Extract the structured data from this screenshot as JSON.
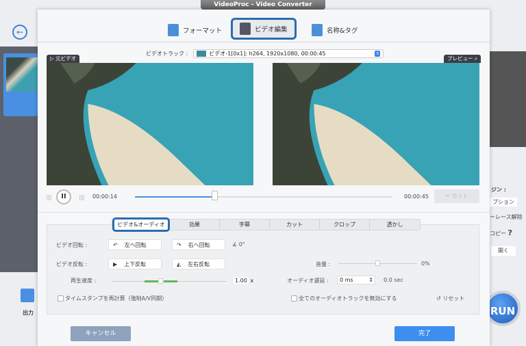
{
  "window": {
    "title": "VideoProc - Video Converter"
  },
  "background": {
    "output_label": "出力",
    "right_panel": {
      "heading": "ジン :",
      "option_btn": "プション",
      "deinterlace": "ーレース解除",
      "copy": "コピー",
      "help": "?",
      "open_btn": "開く"
    },
    "run_label": "RUN"
  },
  "top_tabs": [
    {
      "label": "フォーマット",
      "icon": "format-icon"
    },
    {
      "label": "ビデオ編集",
      "icon": "video-edit-icon",
      "selected": true
    },
    {
      "label": "名称&タグ",
      "icon": "name-tag-icon"
    }
  ],
  "track": {
    "label": "ビデオトラック :",
    "value": "ビデオ-1[0x1]: h264, 1920x1080, 00:00:45"
  },
  "source_label": "▷ 元ビデオ",
  "preview_label": "プレビュー",
  "playback": {
    "current": "00:00:14",
    "total": "00:00:45",
    "progress": 0.31,
    "cut_label": "カット"
  },
  "sub_tabs": [
    "ビデオ&オーディオ",
    "効果",
    "字幕",
    "カット",
    "クロップ",
    "透かし"
  ],
  "settings": {
    "rotate_label": "ビデオ回転 :",
    "rotate_left": "左へ回転",
    "rotate_right": "右へ回転",
    "rotate_angle": "0°",
    "flip_label": "ビデオ反転 :",
    "flip_vertical": "上下反転",
    "flip_horizontal": "左右反転",
    "speed_label": "再生速度 :",
    "speed_value": "1.00",
    "speed_unit": "x",
    "volume_label": "音量 :",
    "volume_value": "0%",
    "audio_delay_label": "オーディオ遅延 :",
    "audio_delay_value": "0 ms",
    "audio_delay_sec": "0.0 sec",
    "timestamp_checkbox": "タイムスタンプを再計算（強制A/V同期）",
    "disable_audio_checkbox": "全てのオーディオトラックを無効にする",
    "reset_label": "リセット"
  },
  "footer": {
    "cancel": "キャンセル",
    "done": "完了"
  }
}
